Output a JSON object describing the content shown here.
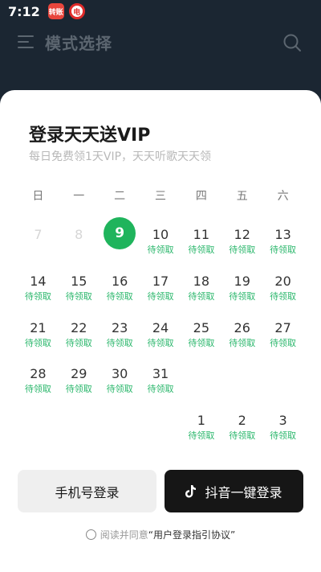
{
  "status_bar": {
    "time": "7:12",
    "badge_1": "转账",
    "badge_2": "电"
  },
  "header": {
    "title": "模式选择"
  },
  "sheet": {
    "title": "登录天天送VIP",
    "subtitle": "每日免费领1天VIP，天天听歌天天领",
    "weekdays": [
      "日",
      "一",
      "二",
      "三",
      "四",
      "五",
      "六"
    ],
    "status_label": "待领取",
    "days": [
      {
        "num": "7",
        "state": "faded"
      },
      {
        "num": "8",
        "state": "faded"
      },
      {
        "num": "9",
        "state": "today"
      },
      {
        "num": "10",
        "state": "pending"
      },
      {
        "num": "11",
        "state": "pending"
      },
      {
        "num": "12",
        "state": "pending"
      },
      {
        "num": "13",
        "state": "pending"
      },
      {
        "num": "14",
        "state": "pending"
      },
      {
        "num": "15",
        "state": "pending"
      },
      {
        "num": "16",
        "state": "pending"
      },
      {
        "num": "17",
        "state": "pending"
      },
      {
        "num": "18",
        "state": "pending"
      },
      {
        "num": "19",
        "state": "pending"
      },
      {
        "num": "20",
        "state": "pending"
      },
      {
        "num": "21",
        "state": "pending"
      },
      {
        "num": "22",
        "state": "pending"
      },
      {
        "num": "23",
        "state": "pending"
      },
      {
        "num": "24",
        "state": "pending"
      },
      {
        "num": "25",
        "state": "pending"
      },
      {
        "num": "26",
        "state": "pending"
      },
      {
        "num": "27",
        "state": "pending"
      },
      {
        "num": "28",
        "state": "pending"
      },
      {
        "num": "29",
        "state": "pending"
      },
      {
        "num": "30",
        "state": "pending"
      },
      {
        "num": "31",
        "state": "pending"
      },
      {
        "num": "",
        "state": "empty"
      },
      {
        "num": "",
        "state": "empty"
      },
      {
        "num": "",
        "state": "empty"
      },
      {
        "num": "",
        "state": "empty"
      },
      {
        "num": "",
        "state": "empty"
      },
      {
        "num": "",
        "state": "empty"
      },
      {
        "num": "",
        "state": "empty"
      },
      {
        "num": "1",
        "state": "pending"
      },
      {
        "num": "2",
        "state": "pending"
      },
      {
        "num": "3",
        "state": "pending"
      }
    ],
    "phone_login_label": "手机号登录",
    "douyin_login_label": "抖音一键登录",
    "agreement_prefix": "阅读并同意",
    "agreement_link": "“用户登录指引协议”"
  },
  "colors": {
    "accent_green": "#1fb45c",
    "header_bg": "#1b2632"
  },
  "icons": {
    "menu": "menu-icon",
    "search": "search-icon",
    "douyin": "douyin-logo-icon",
    "checkbox": "radio-circle-icon"
  }
}
